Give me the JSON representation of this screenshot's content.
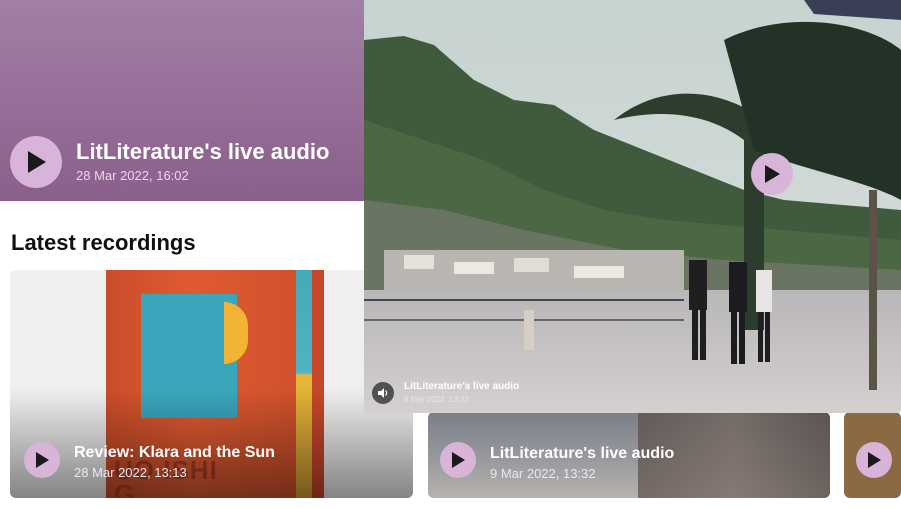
{
  "hero": {
    "title": "LitLiterature's live audio",
    "date": "28 Mar 2022, 16:02"
  },
  "latest": {
    "heading": "Latest recordings",
    "items": [
      {
        "title": "Review: Klara and the Sun",
        "date": "28 Mar 2022, 13:13",
        "cover_text": "UO ISHIG"
      },
      {
        "title": "LitLiterature's live audio",
        "date": "9 Mar 2022, 13:32"
      }
    ]
  },
  "preview": {
    "title": "LitLiterature's live audio",
    "date": "9 Mar 2022, 13:32"
  },
  "icons": {
    "play": "play-icon",
    "speaker": "speaker-icon"
  },
  "colors": {
    "hero_bg": "#8b5f8b",
    "play_button": "#d8b4d9"
  }
}
